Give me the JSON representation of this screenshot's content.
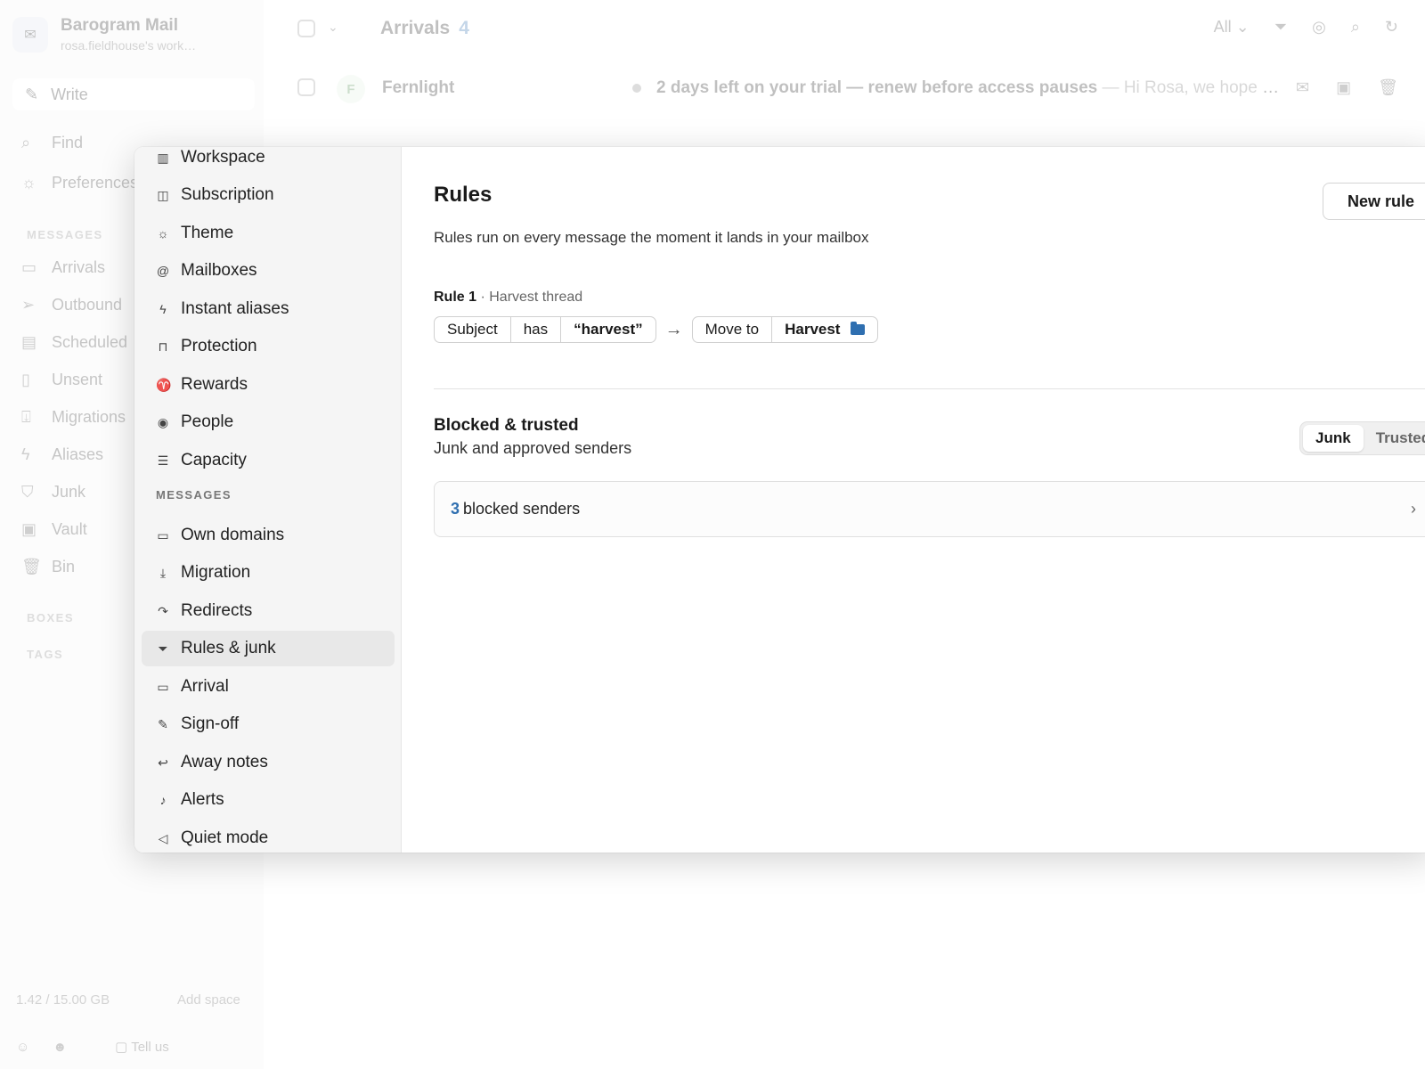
{
  "app": {
    "name": "Barogram Mail",
    "account": "rosa.fieldhouse's work…",
    "write_label": "Write",
    "links": [
      {
        "label": "Find",
        "icon": "search-icon"
      },
      {
        "label": "Preferences",
        "icon": "sun-icon"
      }
    ],
    "messages_heading": "MESSAGES",
    "folders": [
      {
        "label": "Arrivals",
        "icon": "inbox-icon"
      },
      {
        "label": "Outbound",
        "icon": "send-icon"
      },
      {
        "label": "Scheduled",
        "icon": "calendar-icon"
      },
      {
        "label": "Unsent",
        "icon": "draft-icon"
      },
      {
        "label": "Migrations",
        "icon": "import-icon"
      },
      {
        "label": "Aliases",
        "icon": "bolt-icon"
      },
      {
        "label": "Junk",
        "icon": "shield-icon"
      },
      {
        "label": "Vault",
        "icon": "archive-icon"
      },
      {
        "label": "Bin",
        "icon": "trash-icon"
      }
    ],
    "boxes_heading": "BOXES",
    "tags_heading": "TAGS",
    "storage": "1.42 / 15.00 GB",
    "add_space": "Add space",
    "tell_us": "Tell us"
  },
  "mailbox": {
    "title": "Arrivals",
    "count": "4",
    "filter": "All",
    "row": {
      "avatar": "F",
      "sender": "Fernlight",
      "subject": "2 days left on your trial — renew before access pauses",
      "preview": " — Hi Rosa, we hope t…"
    }
  },
  "settings": {
    "nav_top": [
      {
        "label": "Workspace",
        "icon": "building-icon"
      },
      {
        "label": "Subscription",
        "icon": "book-icon"
      },
      {
        "label": "Theme",
        "icon": "sun-icon"
      },
      {
        "label": "Mailboxes",
        "icon": "at-icon"
      },
      {
        "label": "Instant aliases",
        "icon": "bolt-icon"
      },
      {
        "label": "Protection",
        "icon": "lock-icon"
      },
      {
        "label": "Rewards",
        "icon": "trophy-icon"
      },
      {
        "label": "People",
        "icon": "user-circle-icon"
      },
      {
        "label": "Capacity",
        "icon": "storage-icon"
      }
    ],
    "nav_section": "MESSAGES",
    "nav_messages": [
      {
        "label": "Own domains",
        "icon": "browser-icon"
      },
      {
        "label": "Migration",
        "icon": "download-icon"
      },
      {
        "label": "Redirects",
        "icon": "forward-icon"
      },
      {
        "label": "Rules & junk",
        "icon": "filter-icon"
      },
      {
        "label": "Arrival",
        "icon": "inbox-icon"
      },
      {
        "label": "Sign-off",
        "icon": "pen-icon"
      },
      {
        "label": "Away notes",
        "icon": "reply-icon"
      },
      {
        "label": "Alerts",
        "icon": "bell-icon"
      },
      {
        "label": "Quiet mode",
        "icon": "mute-icon"
      }
    ],
    "active": "Rules & junk",
    "rules": {
      "title": "Rules",
      "description": "Rules run on every message the moment it lands in your mailbox",
      "new_rule": "New rule",
      "rule": {
        "number": "Rule 1",
        "name": " · Harvest thread",
        "field": "Subject",
        "operator": "has",
        "value": "“harvest”",
        "action": "Move to",
        "target": "Harvest"
      }
    },
    "blocked": {
      "title": "Blocked & trusted",
      "subtitle": "Junk and approved senders",
      "tab_junk": "Junk",
      "tab_trusted": "Trusted",
      "count": "3",
      "label": "blocked senders"
    }
  }
}
